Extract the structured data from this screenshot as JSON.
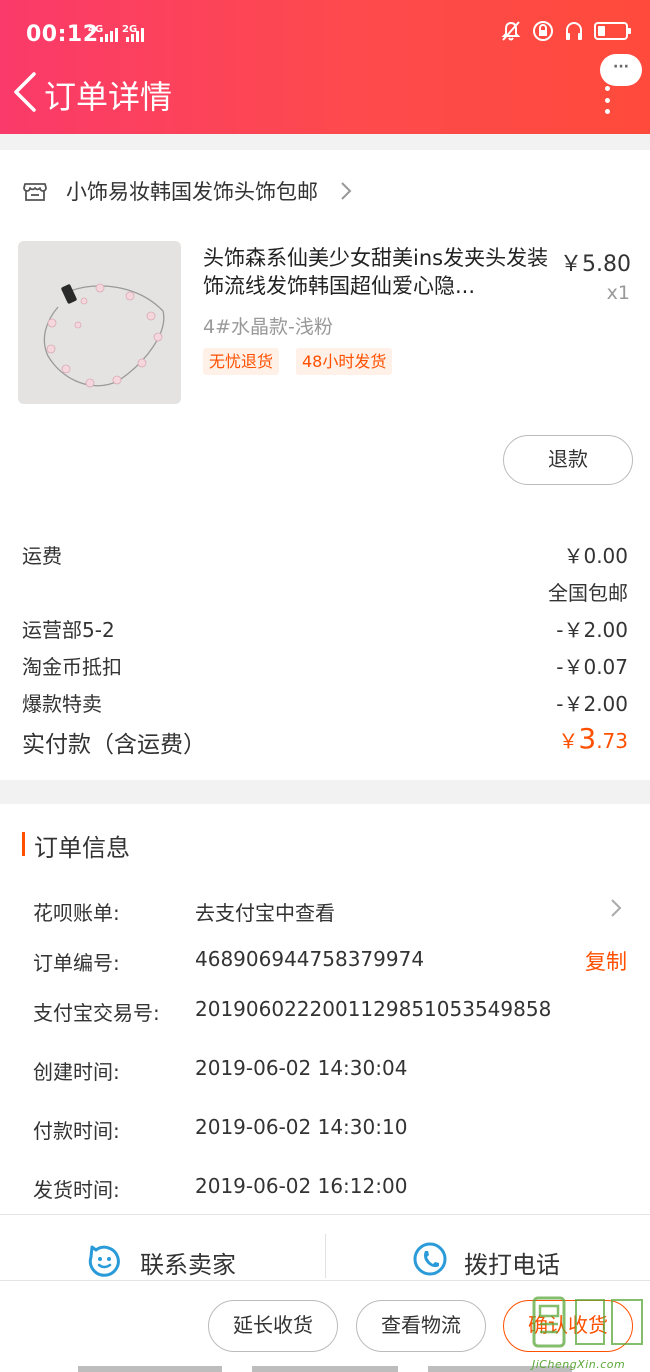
{
  "status_bar": {
    "time": "00:12",
    "net1": "4G",
    "net2": "2G"
  },
  "header": {
    "title": "订单详情",
    "message_icon_label": "···"
  },
  "store": {
    "name": "小饰易妆韩国发饰头饰包邮"
  },
  "product": {
    "title": "头饰森系仙美少女甜美ins发夹头发装饰流线发饰韩国超仙爱心隐...",
    "price": "￥5.80",
    "quantity": "x1",
    "variant": "4#水晶款-浅粉",
    "tags": [
      "无忧退货",
      "48小时发货"
    ],
    "refund_label": "退款"
  },
  "fees": [
    {
      "label": "运费",
      "value": "￥0.00"
    },
    {
      "label": "",
      "value": "全国包邮"
    },
    {
      "label": "运营部5-2",
      "value": "-￥2.00"
    },
    {
      "label": "淘金币抵扣",
      "value": "-￥0.07"
    },
    {
      "label": "爆款特卖",
      "value": "-￥2.00"
    }
  ],
  "total": {
    "label": "实付款（含运费）",
    "currency": "￥",
    "integer": "3",
    "decimal": ".73"
  },
  "order_info": {
    "title": "订单信息",
    "rows": [
      {
        "label": "花呗账单:",
        "value": "去支付宝中查看"
      },
      {
        "label": "订单编号:",
        "value": "468906944758379974"
      },
      {
        "label": "支付宝交易号:",
        "value": "2019060222001129851053549858"
      },
      {
        "label": "创建时间:",
        "value": "2019-06-02 14:30:04"
      },
      {
        "label": "付款时间:",
        "value": "2019-06-02 14:30:10"
      },
      {
        "label": "发货时间:",
        "value": "2019-06-02 16:12:00"
      }
    ],
    "copy_label": "复制"
  },
  "contact": {
    "seller": "联系卖家",
    "phone": "拨打电话"
  },
  "actions": {
    "extend": "延长收货",
    "logistics": "查看物流",
    "confirm": "确认收货"
  },
  "watermark": {
    "text": "JiChengXin.com"
  },
  "colors": {
    "header_start": "#fa3a6a",
    "header_end": "#ff4a3c",
    "accent": "#ff5000",
    "contact_icon": "#2a9bd8"
  }
}
